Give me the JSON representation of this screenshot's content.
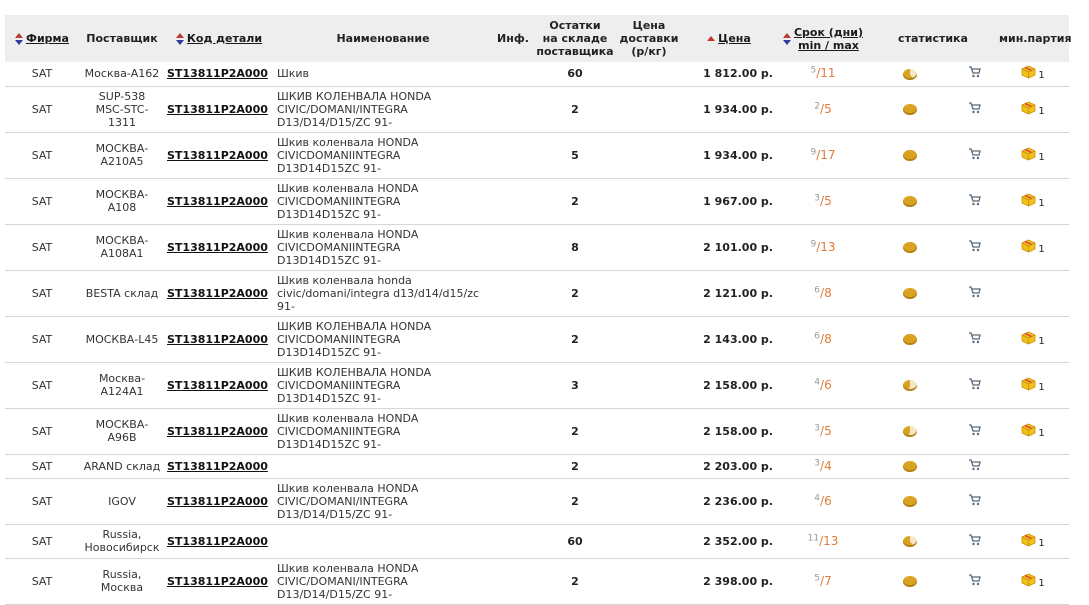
{
  "header": {
    "firm": "Фирма",
    "supplier": "Поставщик",
    "code": "Код детали",
    "name": "Наименование",
    "info": "Инф.",
    "stock_l1": "Остатки",
    "stock_l2": "на складе",
    "stock_l3": "поставщика",
    "delivery_l1": "Цена",
    "delivery_l2": "доставки",
    "delivery_l3": "(р/кг)",
    "price": "Цена",
    "term_l1": "Срок (дни)",
    "term_l2": "min / max",
    "stats": "статистика",
    "min_lot": "мин.партия"
  },
  "colors": {
    "accent_orange": "#e07b39",
    "pie": "#d9a321",
    "row_border": "#d6d6d6",
    "header_bg": "#eeeeee"
  },
  "rows": [
    {
      "firm": "SAT",
      "sup1": "Москва-А162",
      "sup2": "",
      "sup3": "",
      "code": "ST13811P2A000",
      "n1": "Шкив",
      "n2": "",
      "n3": "",
      "stock": "60",
      "price": "1 812.00 р.",
      "tmin": "5",
      "tmax": "11",
      "pie": "part",
      "minq": "1"
    },
    {
      "firm": "SAT",
      "sup1": "SUP-538",
      "sup2": "MSC-STC-",
      "sup3": "1311",
      "code": "ST13811P2A000",
      "n1": "ШКИВ КОЛЕНВАЛА HONDA",
      "n2": "CIVIC/DOMANI/INTEGRA",
      "n3": "D13/D14/D15/ZC 91-",
      "stock": "2",
      "price": "1 934.00 р.",
      "tmin": "2",
      "tmax": "5",
      "pie": "full",
      "minq": "1"
    },
    {
      "firm": "SAT",
      "sup1": "МОСКВА-",
      "sup2": "А210А5",
      "sup3": "",
      "code": "ST13811P2A000",
      "n1": "Шкив коленвала HONDA",
      "n2": "CIVICDOMANIINTEGRA",
      "n3": "D13D14D15ZC 91-",
      "stock": "5",
      "price": "1 934.00 р.",
      "tmin": "9",
      "tmax": "17",
      "pie": "full",
      "minq": "1"
    },
    {
      "firm": "SAT",
      "sup1": "МОСКВА-",
      "sup2": "А108",
      "sup3": "",
      "code": "ST13811P2A000",
      "n1": "Шкив коленвала HONDA",
      "n2": "CIVICDOMANIINTEGRA",
      "n3": "D13D14D15ZC 91-",
      "stock": "2",
      "price": "1 967.00 р.",
      "tmin": "3",
      "tmax": "5",
      "pie": "full",
      "minq": "1"
    },
    {
      "firm": "SAT",
      "sup1": "МОСКВА-",
      "sup2": "А108А1",
      "sup3": "",
      "code": "ST13811P2A000",
      "n1": "Шкив коленвала HONDA",
      "n2": "CIVICDOMANIINTEGRA",
      "n3": "D13D14D15ZC 91-",
      "stock": "8",
      "price": "2 101.00 р.",
      "tmin": "9",
      "tmax": "13",
      "pie": "full",
      "minq": "1"
    },
    {
      "firm": "SAT",
      "sup1": "BESTA склад",
      "sup2": "",
      "sup3": "",
      "code": "ST13811P2A000",
      "n1": "Шкив коленвала honda",
      "n2": "civic/domani/integra d13/d14/d15/zc",
      "n3": "91-",
      "stock": "2",
      "price": "2 121.00 р.",
      "tmin": "6",
      "tmax": "8",
      "pie": "full",
      "minq": ""
    },
    {
      "firm": "SAT",
      "sup1": "МОСКВА-L45",
      "sup2": "",
      "sup3": "",
      "code": "ST13811P2A000",
      "n1": "ШКИВ КОЛЕНВАЛА HONDA",
      "n2": "CIVICDOMANIINTEGRA",
      "n3": "D13D14D15ZC 91-",
      "stock": "2",
      "price": "2 143.00 р.",
      "tmin": "6",
      "tmax": "8",
      "pie": "full",
      "minq": "1"
    },
    {
      "firm": "SAT",
      "sup1": "Москва-",
      "sup2": "А124А1",
      "sup3": "",
      "code": "ST13811P2A000",
      "n1": "ШКИВ КОЛЕНВАЛА HONDA",
      "n2": "CIVICDOMANIINTEGRA",
      "n3": "D13D14D15ZC 91-",
      "stock": "3",
      "price": "2 158.00 р.",
      "tmin": "4",
      "tmax": "6",
      "pie": "part2",
      "minq": "1"
    },
    {
      "firm": "SAT",
      "sup1": "МОСКВА-",
      "sup2": "А96В",
      "sup3": "",
      "code": "ST13811P2A000",
      "n1": "Шкив коленвала HONDA",
      "n2": "CIVICDOMANIINTEGRA",
      "n3": "D13D14D15ZC 91-",
      "stock": "2",
      "price": "2 158.00 р.",
      "tmin": "3",
      "tmax": "5",
      "pie": "part2",
      "minq": "1"
    },
    {
      "firm": "SAT",
      "sup1": "ARAND склад",
      "sup2": "",
      "sup3": "",
      "code": "ST13811P2A000",
      "n1": "",
      "n2": "",
      "n3": "",
      "stock": "2",
      "price": "2 203.00 р.",
      "tmin": "3",
      "tmax": "4",
      "pie": "full",
      "minq": ""
    },
    {
      "firm": "SAT",
      "sup1": "IGOV",
      "sup2": "",
      "sup3": "",
      "code": "ST13811P2A000",
      "n1": "Шкив коленвала HONDA",
      "n2": "CIVIC/DOMANI/INTEGRA",
      "n3": "D13/D14/D15/ZC 91-",
      "stock": "2",
      "price": "2 236.00 р.",
      "tmin": "4",
      "tmax": "6",
      "pie": "full",
      "minq": ""
    },
    {
      "firm": "SAT",
      "sup1": "Russia,",
      "sup2": "Новосибирск",
      "sup3": "",
      "code": "ST13811P2A000",
      "n1": "",
      "n2": "",
      "n3": "",
      "stock": "60",
      "price": "2 352.00 р.",
      "tmin": "11",
      "tmax": "13",
      "pie": "part",
      "minq": "1"
    },
    {
      "firm": "SAT",
      "sup1": "Russia,",
      "sup2": "Москва",
      "sup3": "",
      "code": "ST13811P2A000",
      "n1": "Шкив коленвала HONDA",
      "n2": "CIVIC/DOMANI/INTEGRA",
      "n3": "D13/D14/D15/ZC 91-",
      "stock": "2",
      "price": "2 398.00 р.",
      "tmin": "5",
      "tmax": "7",
      "pie": "full",
      "minq": "1"
    }
  ]
}
